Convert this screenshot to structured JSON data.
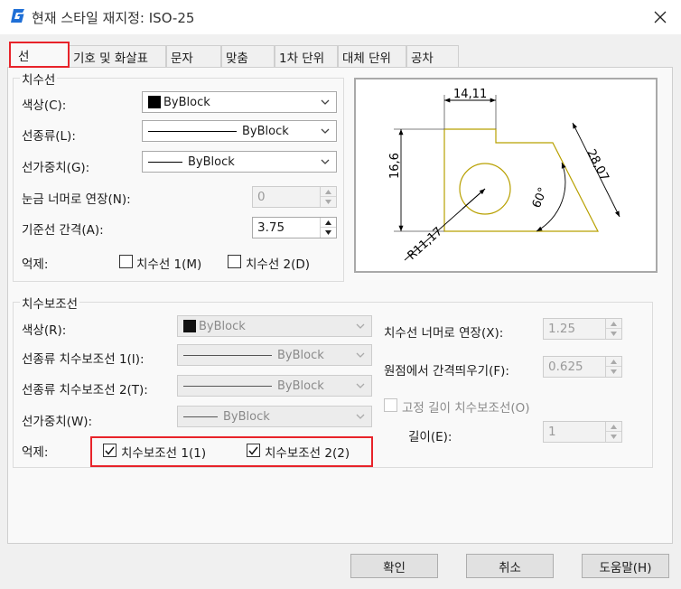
{
  "window": {
    "title": "현재 스타일 재지정: ISO-25"
  },
  "tabs": [
    {
      "label": "선"
    },
    {
      "label": "기호 및 화살표"
    },
    {
      "label": "문자"
    },
    {
      "label": "맞춤"
    },
    {
      "label": "1차 단위"
    },
    {
      "label": "대체 단위"
    },
    {
      "label": "공차"
    }
  ],
  "dim_lines": {
    "group_label": "치수선",
    "color_label": "색상(C):",
    "color_value": "ByBlock",
    "linetype_label": "선종류(L):",
    "linetype_value": "ByBlock",
    "lineweight_label": "선가중치(G):",
    "lineweight_value": "ByBlock",
    "extend_ticks_label": "눈금 너머로 연장(N):",
    "extend_ticks_value": "0",
    "baseline_spacing_label": "기준선 간격(A):",
    "baseline_spacing_value": "3.75",
    "suppress_label": "억제:",
    "suppress_1_label": "치수선 1(M)",
    "suppress_2_label": "치수선 2(D)"
  },
  "ext_lines": {
    "group_label": "치수보조선",
    "color_label": "색상(R):",
    "color_value": "ByBlock",
    "linetype1_label": "선종류 치수보조선 1(I):",
    "linetype1_value": "ByBlock",
    "linetype2_label": "선종류 치수보조선 2(T):",
    "linetype2_value": "ByBlock",
    "lineweight_label": "선가중치(W):",
    "lineweight_value": "ByBlock",
    "suppress_label": "억제:",
    "suppress_1_label": "치수보조선 1(1)",
    "suppress_2_label": "치수보조선 2(2)",
    "extend_beyond_label": "치수선 너머로 연장(X):",
    "extend_beyond_value": "1.25",
    "offset_label": "원점에서 간격띄우기(F):",
    "offset_value": "0.625",
    "fixed_length_label": "고정 길이 치수보조선(O)",
    "length_label": "길이(E):",
    "length_value": "1"
  },
  "preview": {
    "dim_top": "14,11",
    "dim_left": "16,6",
    "dim_diag": "28,07",
    "dim_angle": "60°",
    "dim_radius": "R11,17",
    "line_color": "#b8a000"
  },
  "buttons": {
    "ok": "확인",
    "cancel": "취소",
    "help": "도움말(H)"
  },
  "colors": {
    "highlight": "#e8232a",
    "app_icon": "#1f6fd6"
  }
}
